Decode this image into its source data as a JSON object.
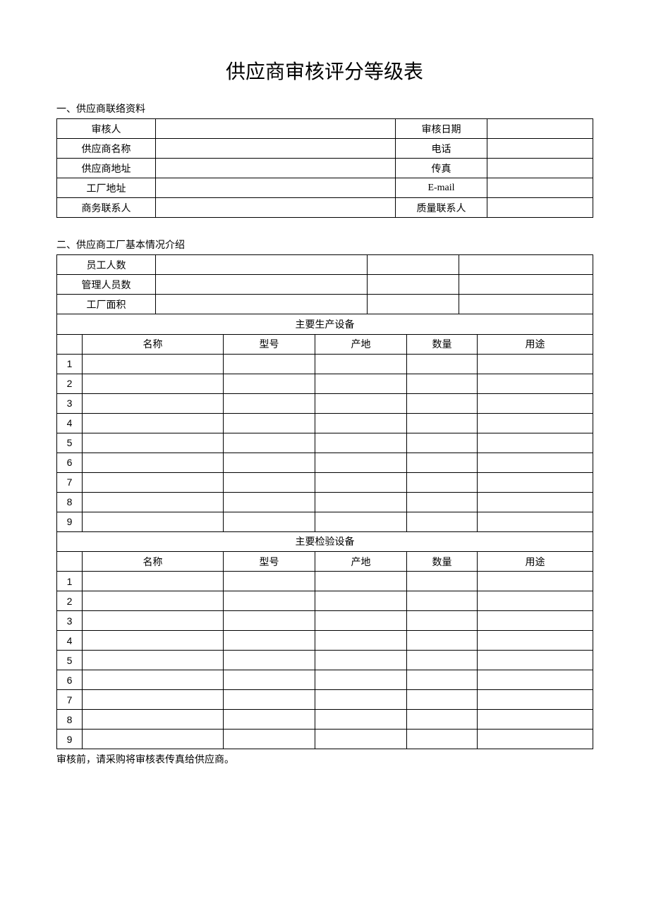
{
  "title": "供应商审核评分等级表",
  "section1": {
    "heading": "一、供应商联络资料",
    "rows": {
      "auditor": "审核人",
      "audit_date": "审核日期",
      "supplier_name": "供应商名称",
      "phone": "电话",
      "supplier_addr": "供应商地址",
      "fax": "传真",
      "factory_addr": "工厂地址",
      "email": "E-mail",
      "biz_contact": "商务联系人",
      "quality_contact": "质量联系人"
    }
  },
  "section2": {
    "heading": "二、供应商工厂基本情况介绍",
    "info_rows": {
      "employees": "员工人数",
      "managers": "管理人员数",
      "area": "工厂面积"
    },
    "equip_prod_header": "主要生产设备",
    "equip_inspect_header": "主要检验设备",
    "equip_cols": {
      "name": "名称",
      "model": "型号",
      "origin": "产地",
      "qty": "数量",
      "use": "用途"
    },
    "prod_rows": [
      "1",
      "2",
      "3",
      "4",
      "5",
      "6",
      "7",
      "8",
      "9"
    ],
    "inspect_rows": [
      "1",
      "2",
      "3",
      "4",
      "5",
      "6",
      "7",
      "8",
      "9"
    ]
  },
  "footer": "审核前，请采购将审核表传真给供应商。"
}
